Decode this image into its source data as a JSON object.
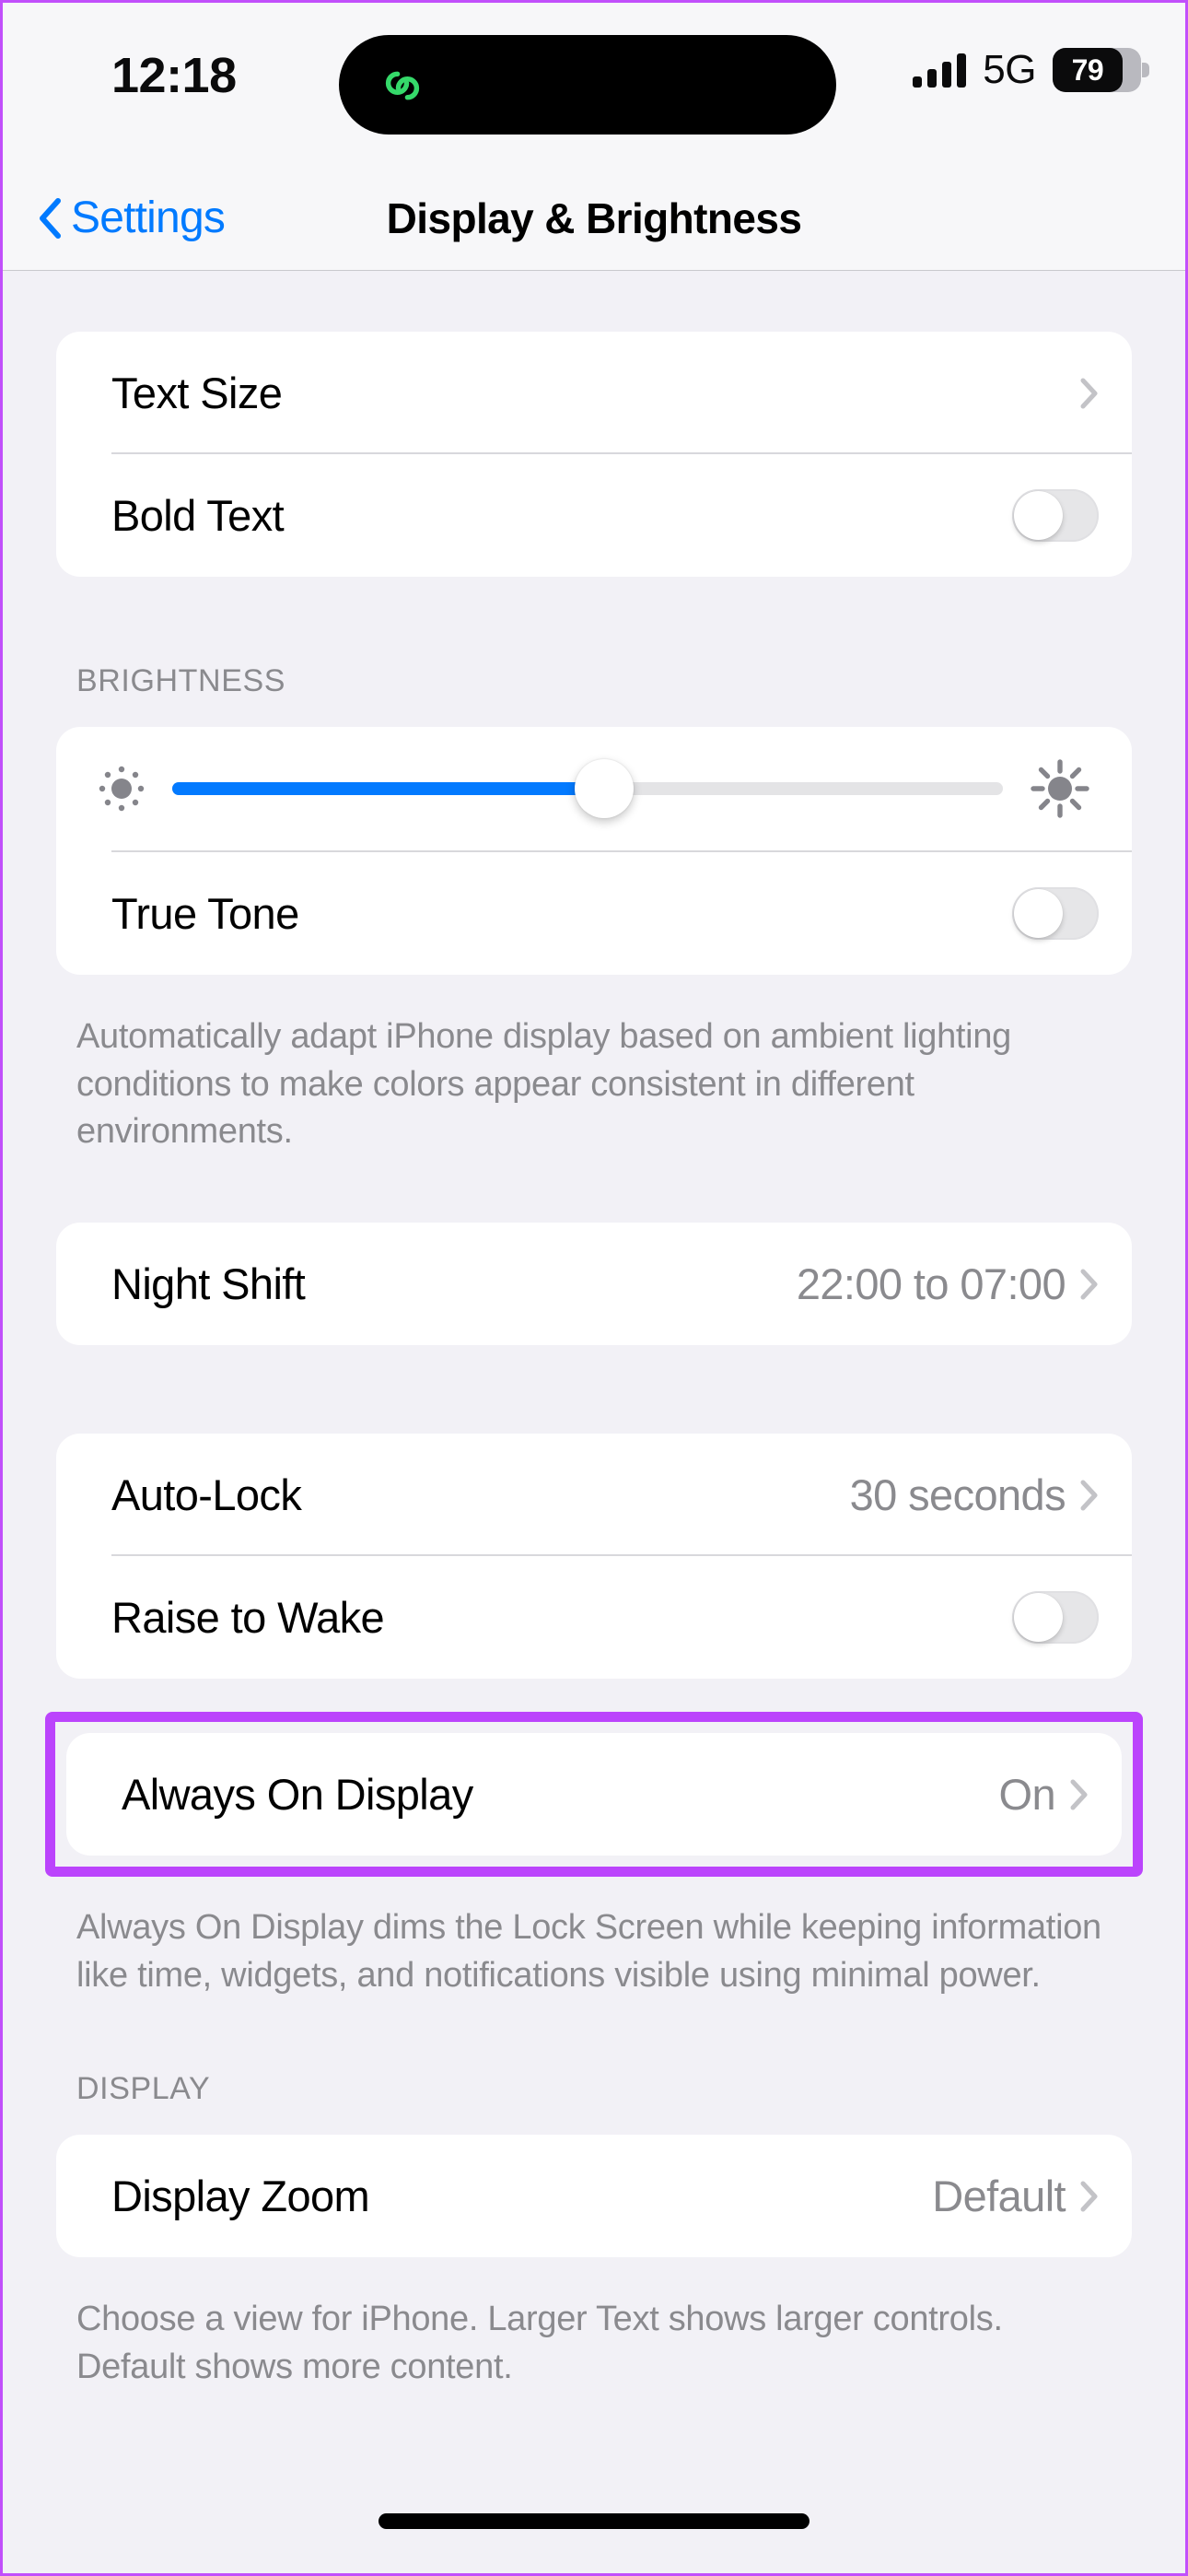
{
  "status_bar": {
    "time": "12:18",
    "network": "5G",
    "battery_percent": "79",
    "battery_level": 79,
    "signal_bars": 4,
    "island_icon": "activity-link-icon",
    "island_icon_color": "#35d96a"
  },
  "nav": {
    "back_label": "Settings",
    "title": "Display & Brightness",
    "accent_color": "#007aff"
  },
  "groups": {
    "text": {
      "rows": [
        {
          "label": "Text Size",
          "value": "",
          "type": "disclosure"
        },
        {
          "label": "Bold Text",
          "value": "",
          "type": "toggle",
          "on": false
        }
      ]
    },
    "brightness": {
      "header": "BRIGHTNESS",
      "slider": {
        "value_percent": 52,
        "min_icon": "sun-min-icon",
        "max_icon": "sun-max-icon",
        "fill_color": "#037aff"
      },
      "true_tone": {
        "label": "True Tone",
        "type": "toggle",
        "on": false
      },
      "footer": "Automatically adapt iPhone display based on ambient lighting conditions to make colors appear consistent in different environments."
    },
    "night_shift": {
      "rows": [
        {
          "label": "Night Shift",
          "value": "22:00 to 07:00",
          "type": "disclosure"
        }
      ]
    },
    "lock": {
      "rows": [
        {
          "label": "Auto-Lock",
          "value": "30 seconds",
          "type": "disclosure"
        },
        {
          "label": "Raise to Wake",
          "value": "",
          "type": "toggle",
          "on": false
        }
      ]
    },
    "always_on_display": {
      "label": "Always On Display",
      "value": "On",
      "highlight_color": "#bb44fc",
      "footer": "Always On Display dims the Lock Screen while keeping information like time, widgets, and notifications visible using minimal power."
    },
    "display": {
      "header": "DISPLAY",
      "rows": [
        {
          "label": "Display Zoom",
          "value": "Default",
          "type": "disclosure"
        }
      ],
      "footer": "Choose a view for iPhone. Larger Text shows larger controls. Default shows more content."
    }
  }
}
